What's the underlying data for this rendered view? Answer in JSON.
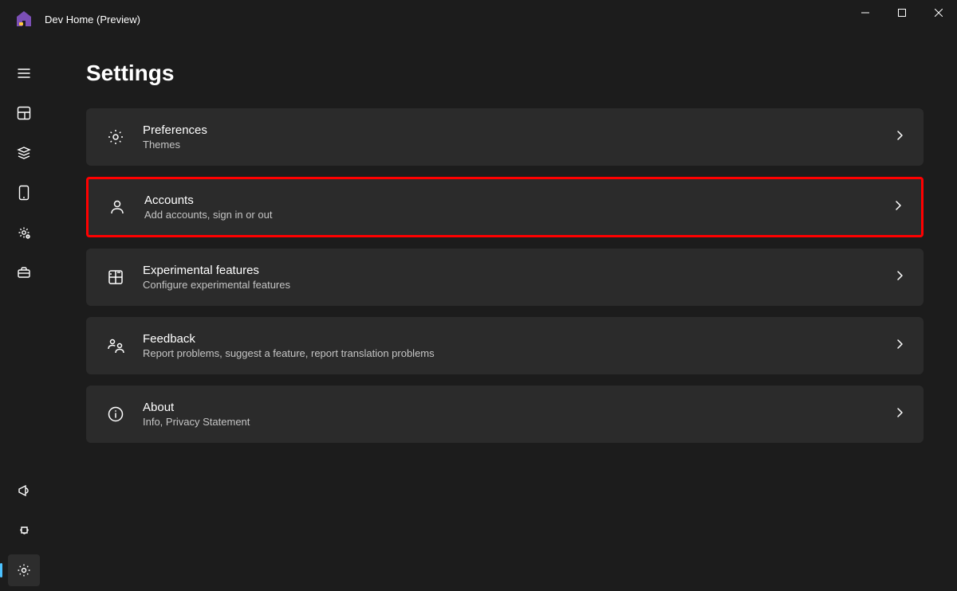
{
  "app": {
    "title": "Dev Home (Preview)"
  },
  "page": {
    "title": "Settings"
  },
  "settings_items": [
    {
      "title": "Preferences",
      "subtitle": "Themes"
    },
    {
      "title": "Accounts",
      "subtitle": "Add accounts, sign in or out"
    },
    {
      "title": "Experimental features",
      "subtitle": "Configure experimental features"
    },
    {
      "title": "Feedback",
      "subtitle": "Report problems, suggest a feature, report translation problems"
    },
    {
      "title": "About",
      "subtitle": "Info, Privacy Statement"
    }
  ]
}
